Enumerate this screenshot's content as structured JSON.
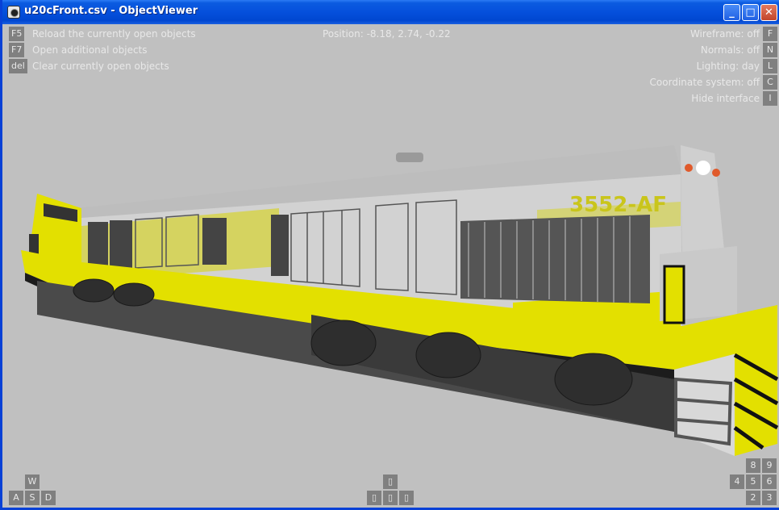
{
  "window": {
    "title": "u20cFront.csv - ObjectViewer",
    "controls": {
      "minimize": "_",
      "maximize": "□",
      "close": "✕"
    }
  },
  "left_menu": [
    {
      "key": "F5",
      "label": "Reload the currently open objects"
    },
    {
      "key": "F7",
      "label": "Open additional objects"
    },
    {
      "key": "del",
      "label": "Clear currently open objects"
    }
  ],
  "position": {
    "label": "Position: -8.18, 2.74, -0.22"
  },
  "right_menu": [
    {
      "label": "Wireframe: off",
      "key": "F"
    },
    {
      "label": "Normals: off",
      "key": "N"
    },
    {
      "label": "Lighting: day",
      "key": "L"
    },
    {
      "label": "Coordinate system: off",
      "key": "C"
    },
    {
      "label": "Hide interface",
      "key": "I"
    }
  ],
  "wasd": {
    "w": "W",
    "a": "A",
    "s": "S",
    "d": "D"
  },
  "arrows": {
    "up": "▯",
    "left": "▯",
    "down": "▯",
    "right": "▯"
  },
  "numpad": {
    "k8": "8",
    "k9": "9",
    "k4": "4",
    "k5": "5",
    "k6": "6",
    "k2": "2",
    "k3": "3"
  },
  "scene": {
    "loco_number": "3552-AF",
    "colors": {
      "yellow": "#e3e000",
      "body": "#d2d2d2",
      "dark": "#2a2a2a",
      "background": "#c0c0c0"
    }
  }
}
